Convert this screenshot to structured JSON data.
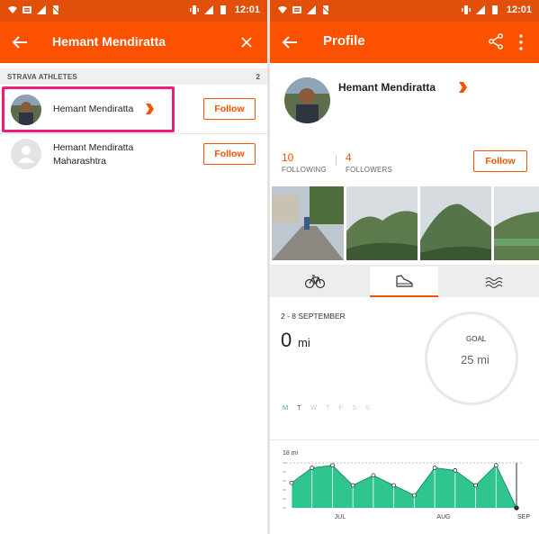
{
  "status_bar": {
    "left": {
      "time": "12:01"
    },
    "right": {
      "time": "12:01"
    }
  },
  "search_screen": {
    "search_value": "Hemant Mendiratta",
    "section_title": "STRAVA ATHLETES",
    "section_count": "2",
    "results": [
      {
        "name": "Hemant Mendiratta",
        "location": "",
        "follow_label": "Follow",
        "verified": true
      },
      {
        "name": "Hemant Mendiratta",
        "location": "Maharashtra",
        "follow_label": "Follow",
        "verified": false
      }
    ]
  },
  "profile_screen": {
    "title": "Profile",
    "name": "Hemant Mendiratta",
    "following_count": "10",
    "following_label": "FOLLOWING",
    "followers_count": "4",
    "followers_label": "FOLLOWERS",
    "follow_label": "Follow",
    "week": "2 - 8 SEPTEMBER",
    "distance_value": "0",
    "distance_unit": "mi",
    "goal_label": "GOAL",
    "goal_value": "25 mi",
    "days": [
      "M",
      "T",
      "W",
      "T",
      "F",
      "S",
      "S"
    ],
    "tabs": [
      {
        "name": "ride",
        "icon": "bike-icon"
      },
      {
        "name": "run",
        "icon": "shoe-icon",
        "active": true
      },
      {
        "name": "swim",
        "icon": "waves-icon"
      }
    ]
  },
  "colors": {
    "status_bar": "#e14f09",
    "app_bar": "#fc5200",
    "accent": "#fc5200",
    "chart_fill": "#2fc58f",
    "highlight": "#ec1e79"
  },
  "chart_data": {
    "type": "area",
    "ylabel": "18 mi",
    "ylim": [
      0,
      18
    ],
    "x_labels": [
      "JUL",
      "AUG",
      "SEP"
    ],
    "values": [
      10,
      16,
      17,
      9,
      13,
      9,
      5,
      16,
      15,
      9,
      17,
      0
    ]
  }
}
